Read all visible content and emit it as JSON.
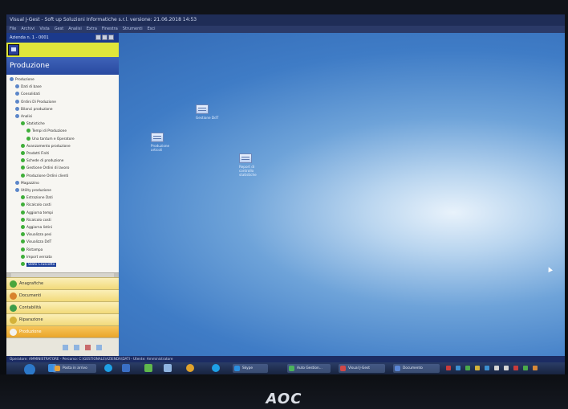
{
  "window": {
    "title": "Visual J-Gest - Soft up Soluzioni Informatiche s.r.l. versione: 21.06.2018 14:53",
    "menu": [
      "File",
      "Archivi",
      "Vista",
      "Gest",
      "Analisi",
      "Extra",
      "Finestra",
      "Strumenti",
      "Esci"
    ],
    "mdi_title": "Azienda n. 1 - 0001"
  },
  "panel": {
    "header": "Produzione",
    "tree": [
      {
        "label": "Produzione",
        "level": 0
      },
      {
        "label": "Dati di base",
        "level": 1
      },
      {
        "label": "Consolidati",
        "level": 1
      },
      {
        "label": "Ordini Di Produzione",
        "level": 1
      },
      {
        "label": "Bilanci produzione",
        "level": 1
      },
      {
        "label": "Analisi",
        "level": 1
      },
      {
        "label": "Statistiche",
        "level": 2
      },
      {
        "label": "Tempi di Produzione",
        "level": 3
      },
      {
        "label": "Una tantum e Operatore",
        "level": 3
      },
      {
        "label": "Avanzamento produzione",
        "level": 2
      },
      {
        "label": "Prodotti Finiti",
        "level": 2
      },
      {
        "label": "Schede di produzione",
        "level": 2
      },
      {
        "label": "Gestione Ordini di lavoro",
        "level": 2
      },
      {
        "label": "Produzione Ordini clienti",
        "level": 2
      },
      {
        "label": "Magazzino",
        "level": 1
      },
      {
        "label": "Utility produzione",
        "level": 1
      },
      {
        "label": "Estrazione Dati",
        "level": 2
      },
      {
        "label": "Ricalcolo costi",
        "level": 2
      },
      {
        "label": "Aggiorna tempi",
        "level": 2
      },
      {
        "label": "Ricalcolo costi",
        "level": 2
      },
      {
        "label": "Aggiorna listini",
        "level": 2
      },
      {
        "label": "Visualizza pesi",
        "level": 2
      },
      {
        "label": "Visualizza DdT",
        "level": 2
      },
      {
        "label": "Ristampa",
        "level": 2
      },
      {
        "label": "Import versato",
        "level": 2
      },
      {
        "label": "Stato Cruscotto",
        "level": 2,
        "selected": true
      }
    ],
    "accordion": [
      {
        "label": "Anagrafiche",
        "color": "#4aa63c"
      },
      {
        "label": "Documenti",
        "color": "#d8822c"
      },
      {
        "label": "Contabilità",
        "color": "#3c9c4a"
      },
      {
        "label": "Riparazione",
        "color": "#d4b23a"
      },
      {
        "label": "Produzione",
        "color": "#f2f2f2",
        "active": true
      }
    ]
  },
  "desktop": {
    "icons": [
      {
        "label": "Gestione DdT"
      },
      {
        "label": "Produzione articoli"
      },
      {
        "label": "Report di controllo statistiche"
      }
    ]
  },
  "statusbar": {
    "text": "Operatore: AMMINISTRATORE - Percorso: C:\\GESTIONALE\\AZIENDA\\DATI - Utente: Amministratore"
  },
  "taskbar": {
    "items": [
      {
        "label": "Posta in arrivo",
        "color": "#e7a23a"
      },
      {
        "label": "Skype",
        "color": "#2b8fe0"
      },
      {
        "label": "Auto Gestion...",
        "color": "#4bb35c"
      },
      {
        "label": "Visual J-Gest",
        "color": "#d04848"
      },
      {
        "label": "Documento",
        "color": "#5a86d6"
      }
    ],
    "pinned": [
      {
        "icon": "windows-start-icon",
        "color": "#2c78c9"
      },
      {
        "icon": "internet-explorer-icon",
        "color": "#3c8fe0"
      },
      {
        "icon": "skype-icon",
        "color": "#1ea0e6"
      },
      {
        "icon": "media-icon",
        "color": "#3a6fc5"
      },
      {
        "icon": "network-icon",
        "color": "#5fb84c"
      },
      {
        "icon": "gallery-icon",
        "color": "#8fb4e0"
      },
      {
        "icon": "chrome-icon",
        "color": "#e0a22c"
      },
      {
        "icon": "skype-alt-icon",
        "color": "#1ea0e6"
      }
    ],
    "tray": [
      "#c93b3b",
      "#3b8fd1",
      "#4aaa4a",
      "#d4b23a",
      "#3b8fd1",
      "#d4d4d4",
      "#d4d4d4",
      "#c93b3b",
      "#4aaa4a",
      "#d88838"
    ]
  },
  "monitor": {
    "brand": "AOC"
  }
}
